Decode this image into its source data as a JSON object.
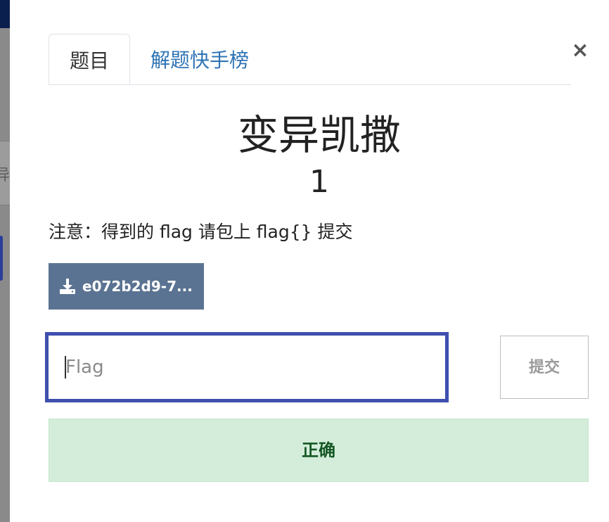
{
  "modal": {
    "close_label": "×",
    "tabs": [
      {
        "label": "题目",
        "active": true
      },
      {
        "label": "解题快手榜",
        "active": false
      }
    ],
    "challenge": {
      "name": "变异凯撒",
      "value": "1",
      "description": "注意：得到的 flag 请包上 flag{} 提交",
      "file_label": "e072b2d9-7..."
    },
    "form": {
      "flag_placeholder": "Flag",
      "submit_label": "提交"
    },
    "result": {
      "message": "正确",
      "status_color": "#d4edda"
    }
  },
  "backdrop": {
    "partial_text": "异"
  },
  "colors": {
    "accent": "#3f4fae",
    "link": "#2f74b5",
    "file_button": "#5b7392",
    "success_text": "#155724"
  }
}
